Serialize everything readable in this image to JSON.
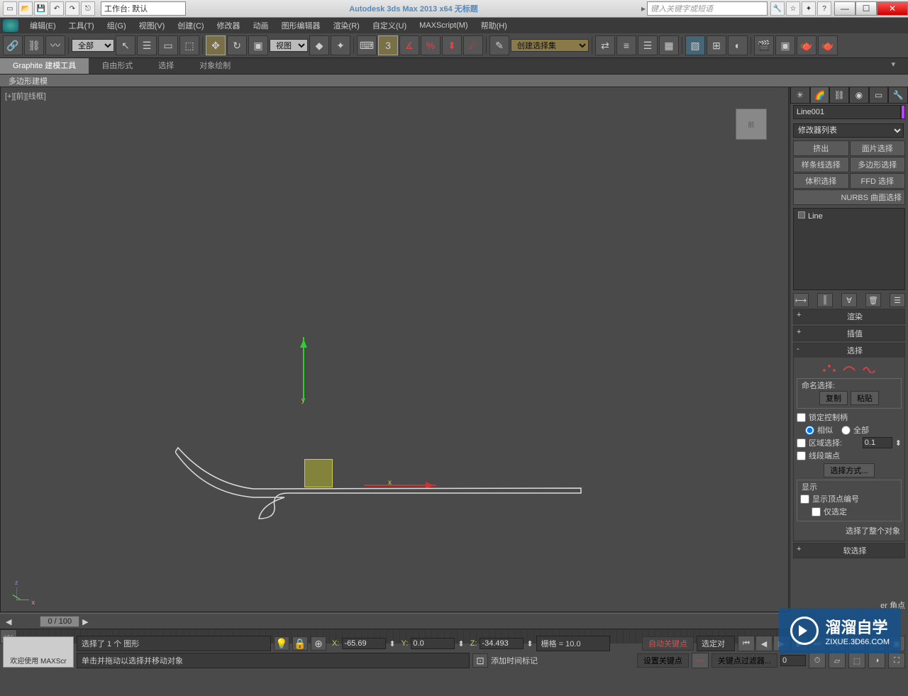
{
  "titlebar": {
    "workspace_label": "工作台: 默认",
    "app_title": "Autodesk 3ds Max  2013 x64    无标题",
    "search_placeholder": "键入关键字或短语"
  },
  "menu": {
    "items": [
      "编辑(E)",
      "工具(T)",
      "组(G)",
      "视图(V)",
      "创建(C)",
      "修改器",
      "动画",
      "图形编辑器",
      "渲染(R)",
      "自定义(U)",
      "MAXScript(M)",
      "帮助(H)"
    ]
  },
  "toolbar": {
    "filter": "全部",
    "refcoord": "视图",
    "selset": "创建选择集"
  },
  "ribbon": {
    "tabs": [
      "Graphite 建模工具",
      "自由形式",
      "选择",
      "对象绘制"
    ],
    "sub": "多边形建模"
  },
  "viewport": {
    "label": "[+][前][线框]",
    "cube": "前",
    "axis_y": "y",
    "axis_x": "x",
    "axis_z": "z"
  },
  "cmdpanel": {
    "obj_name": "Line001",
    "mod_list": "修改器列表",
    "mods": [
      "挤出",
      "面片选择",
      "样条线选择",
      "多边形选择",
      "体积选择",
      "FFD 选择"
    ],
    "nurbs": "NURBS 曲面选择",
    "stack_item": "Line",
    "rollouts": {
      "render": "渲染",
      "interp": "插值",
      "select": "选择",
      "soft": "软选择"
    },
    "sel": {
      "naming": "命名选择:",
      "copy": "复制",
      "paste": "粘贴",
      "lock": "锁定控制柄",
      "similar": "相似",
      "all": "全部",
      "area": "区域选择:",
      "area_val": "0.1",
      "segend": "线段端点",
      "sel_method": "选择方式...",
      "display": "显示",
      "show_num": "显示顶点编号",
      "only_sel": "仅选定",
      "whole": "选择了整个对象"
    },
    "corner_label": "er 角点"
  },
  "timeslider": {
    "label": "0 / 100"
  },
  "statusbar": {
    "maxscript": "欢迎使用  MAXScr",
    "sel_msg": "选择了 1 个 图形",
    "hint": "单击并拖动以选择并移动对象",
    "x": "-65.69",
    "y": "0.0",
    "z": "-34.493",
    "grid": "栅格 = 10.0",
    "add_time": "添加时间标记",
    "autokey": "自动关键点",
    "setkey": "设置关键点",
    "keyfilter": "关键点过滤器...",
    "selset": "选定对"
  },
  "watermark": {
    "big": "溜溜自学",
    "small": "ZIXUE.3D66.COM"
  }
}
